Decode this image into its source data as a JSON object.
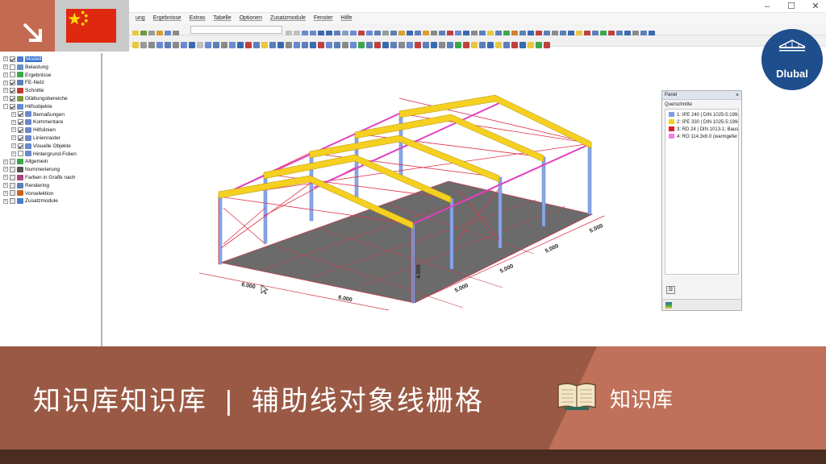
{
  "window": {
    "controls": [
      "–",
      "☐",
      "✕"
    ]
  },
  "menubar": [
    "ung",
    "Ergebnisse",
    "Extras",
    "Tabelle",
    "Optionen",
    "Zusatzmodule",
    "Fenster",
    "Hilfe"
  ],
  "navigator": {
    "items": [
      {
        "label": "Modell",
        "checked": true,
        "selected": true,
        "indent": 0,
        "color": "#4a7bd0"
      },
      {
        "label": "Belastung",
        "checked": false,
        "indent": 0,
        "color": "#6b8fc6"
      },
      {
        "label": "Ergebnisse",
        "checked": false,
        "indent": 0,
        "color": "#3aa84a"
      },
      {
        "label": "FE-Netz",
        "checked": true,
        "indent": 0,
        "color": "#5c7fb8"
      },
      {
        "label": "Schnitte",
        "checked": true,
        "indent": 0,
        "color": "#c0392b"
      },
      {
        "label": "Glättungsbereiche",
        "checked": true,
        "indent": 0,
        "color": "#7a9a3a"
      },
      {
        "label": "Hilfsobjekte",
        "checked": true,
        "indent": 0,
        "color": "#6a8ad0",
        "expanded": true
      },
      {
        "label": "Bemaßungen",
        "checked": true,
        "indent": 1,
        "color": "#6a8ad0"
      },
      {
        "label": "Kommentare",
        "checked": true,
        "indent": 1,
        "color": "#6a8ad0"
      },
      {
        "label": "Hilfslinien",
        "checked": true,
        "indent": 1,
        "color": "#6a8ad0"
      },
      {
        "label": "Linienraster",
        "checked": true,
        "indent": 1,
        "color": "#6a8ad0"
      },
      {
        "label": "Visuelle Objekte",
        "checked": true,
        "indent": 1,
        "color": "#6a8ad0"
      },
      {
        "label": "Hintergrund-Folien",
        "checked": false,
        "indent": 1,
        "color": "#6a8ad0"
      },
      {
        "label": "Allgemein",
        "checked": null,
        "indent": 0,
        "color": "#3aa84a"
      },
      {
        "label": "Nummerierung",
        "checked": null,
        "indent": 0,
        "color": "#555555"
      },
      {
        "label": "Farben in Grafik nach",
        "checked": null,
        "indent": 0,
        "color": "#b04080"
      },
      {
        "label": "Rendering",
        "checked": null,
        "indent": 0,
        "color": "#5c7fb8"
      },
      {
        "label": "Vorselektion",
        "checked": null,
        "indent": 0,
        "color": "#d06020"
      },
      {
        "label": "Zusatzmodule",
        "checked": null,
        "indent": 0,
        "color": "#4a7bd0"
      }
    ]
  },
  "model": {
    "dimensions": {
      "width_left": "6.000",
      "width_right": "6.000",
      "height": "4.000",
      "bay_1": "5.000",
      "bay_2": "5.000",
      "bay_3": "5.000",
      "bay_4": "5.000"
    }
  },
  "panel": {
    "title": "Panel",
    "close": "×",
    "subtitle": "Querschnitte",
    "legend": [
      {
        "label": "1: IPE 240 | DIN 1025-5:1994",
        "color": "#7a9ee6"
      },
      {
        "label": "2: IPE 330 | DIN 1025-5:1994",
        "color": "#f5d020"
      },
      {
        "label": "3: RD 24 | DIN 1013-1; Baust",
        "color": "#e02020"
      },
      {
        "label": "4: RO 114.3x6.0 (warmgefer",
        "color": "#f080e8"
      }
    ]
  },
  "logo": {
    "text": "Dlubal"
  },
  "banner": {
    "title_left": "知识库知识库",
    "separator": "|",
    "title_right": "辅助线对象线栅格",
    "tag": "知识库"
  },
  "colors": {
    "banner": "#9a5944",
    "banner_light": "#c0715a",
    "accent": "#c46a51",
    "dlubal_blue": "#1e4e8c",
    "frame_red": "#e0304a",
    "purlin_pink": "#e040c0",
    "rafter_yellow": "#f5d020",
    "column_blue": "#7a9ee6"
  }
}
